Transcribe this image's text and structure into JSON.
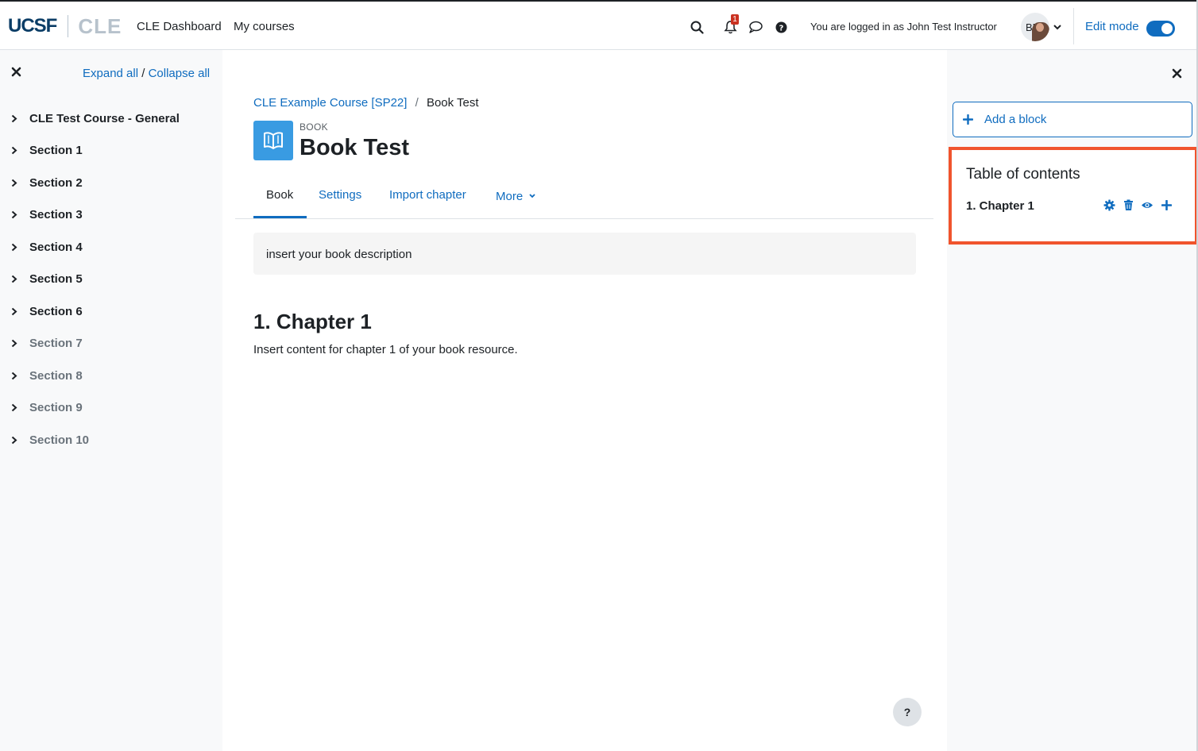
{
  "header": {
    "logo_primary": "UCSF",
    "logo_secondary": "CLE",
    "nav_links": [
      "CLE Dashboard",
      "My courses"
    ],
    "notification_count": "1",
    "logged_in_text": "You are logged in as John Test Instructor",
    "avatar_initials": "BM",
    "edit_mode_label": "Edit mode",
    "edit_mode_on": true
  },
  "left_drawer": {
    "expand_all": "Expand all",
    "separator": "/",
    "collapse_all": "Collapse all",
    "sections": [
      {
        "label": "CLE Test Course - General",
        "dim": false
      },
      {
        "label": "Section 1",
        "dim": false
      },
      {
        "label": "Section 2",
        "dim": false
      },
      {
        "label": "Section 3",
        "dim": false
      },
      {
        "label": "Section 4",
        "dim": false
      },
      {
        "label": "Section 5",
        "dim": false
      },
      {
        "label": "Section 6",
        "dim": false
      },
      {
        "label": "Section 7",
        "dim": true
      },
      {
        "label": "Section 8",
        "dim": true
      },
      {
        "label": "Section 9",
        "dim": true
      },
      {
        "label": "Section 10",
        "dim": true
      }
    ]
  },
  "main": {
    "breadcrumb": {
      "course": "CLE Example Course [SP22]",
      "separator": "/",
      "current": "Book Test"
    },
    "module_type": "BOOK",
    "title": "Book Test",
    "tabs": [
      "Book",
      "Settings",
      "Import chapter",
      "More"
    ],
    "active_tab": "Book",
    "description": "insert your book description",
    "chapter_title": "1. Chapter 1",
    "chapter_content": "Insert content for chapter 1 of your book resource.",
    "help_label": "?"
  },
  "right_drawer": {
    "add_block_label": "Add a block",
    "toc_title": "Table of contents",
    "toc_items": [
      "1. Chapter 1"
    ],
    "toc_action_icons": [
      "gear-icon",
      "trash-icon",
      "eye-icon",
      "plus-icon"
    ],
    "highlight_color": "#f0542d"
  },
  "colors": {
    "accent": "#0f6cbf",
    "book_icon_bg": "#399be2",
    "notification_badge": "#ca3120"
  }
}
